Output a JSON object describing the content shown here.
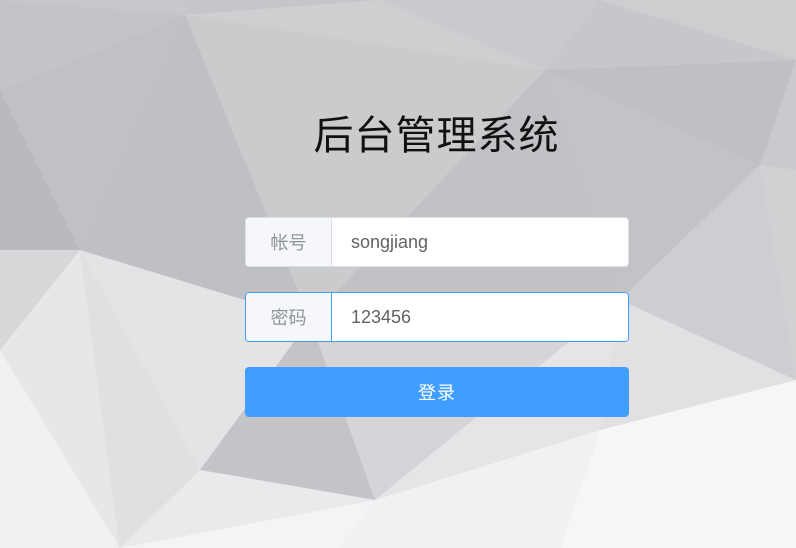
{
  "page": {
    "title": "后台管理系统"
  },
  "form": {
    "username": {
      "label": "帐号",
      "value": "songjiang"
    },
    "password": {
      "label": "密码",
      "value": "123456"
    },
    "submit_label": "登录"
  },
  "colors": {
    "accent": "#409eff",
    "background": "#d3d4d6"
  }
}
